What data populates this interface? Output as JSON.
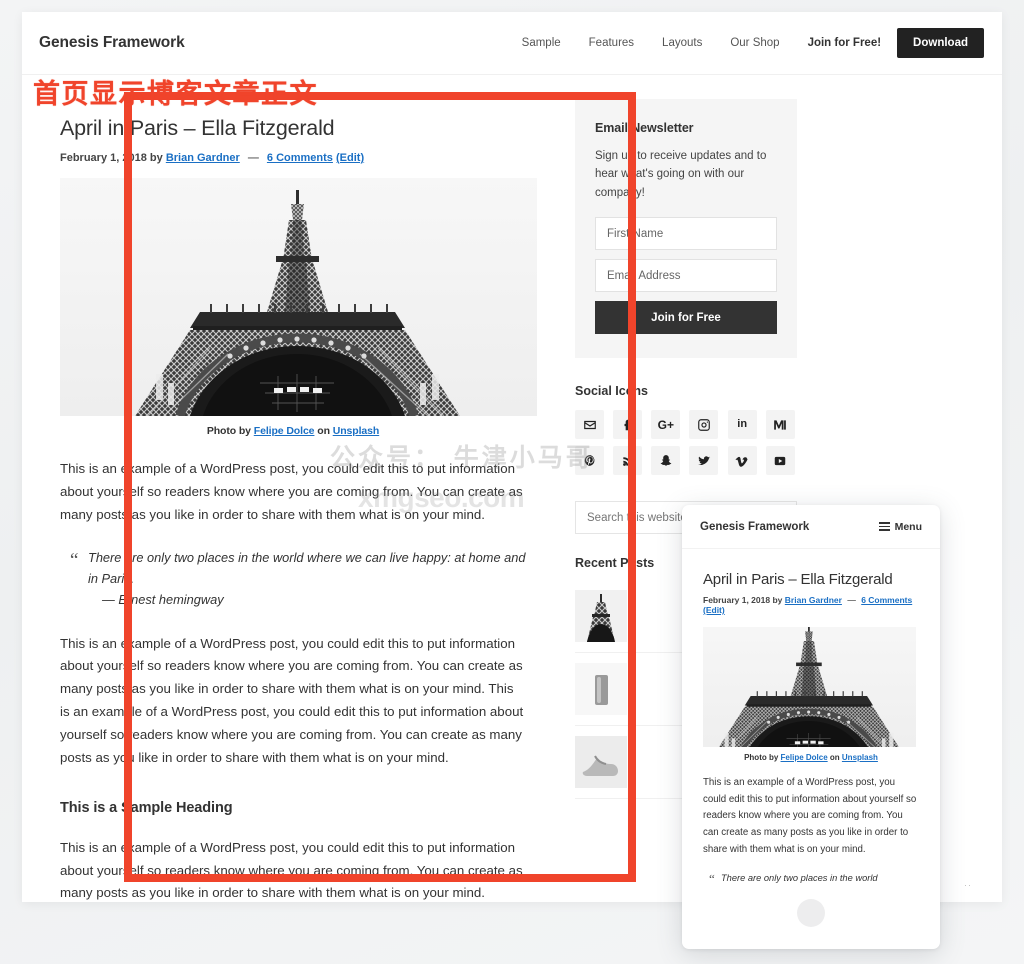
{
  "site": {
    "title": "Genesis Framework",
    "nav": [
      {
        "label": "Sample",
        "bold": false
      },
      {
        "label": "Features",
        "bold": false
      },
      {
        "label": "Layouts",
        "bold": false
      },
      {
        "label": "Our Shop",
        "bold": false
      },
      {
        "label": "Join for Free!",
        "bold": true
      }
    ],
    "download_button": "Download"
  },
  "annotation": {
    "text": "首页显示博客文章正文",
    "color": "#f0442b"
  },
  "watermark": {
    "line1": "公众号： 牛津小马哥",
    "line2": "xmgseo.com"
  },
  "post": {
    "title": "April in Paris – Ella Fitzgerald",
    "date": "February 1, 2018",
    "by_label": "by",
    "author": "Brian Gardner",
    "dash": "—",
    "comments": "6 Comments",
    "edit": "(Edit)",
    "photo_credit_prefix": "Photo by",
    "photo_author": "Felipe Dolce",
    "photo_on": "on",
    "photo_source": "Unsplash",
    "paragraph_1": "This is an example of a WordPress post, you could edit this to put information about yourself so readers know where you are coming from. You can create as many posts as you like in order to share with them what is on your mind.",
    "quote": "There are only two places in the world where we can live happy: at home and in Paris.",
    "quote_attribution": "— Ernest hemingway",
    "paragraph_2": "This is an example of a WordPress post, you could edit this to put information about yourself so readers know where you are coming from. You can create as many posts as you like in order to share with them what is on your mind. This is an example of a WordPress post, you could edit this to put information about yourself so readers know where you are coming from. You can create as many posts as you like in order to share with them what is on your mind.",
    "subheading": "This is a Sample Heading",
    "paragraph_3": "This is an example of a WordPress post, you could edit this to put information about yourself so readers know where you are coming from. You can create as many posts as you like in order to share with them what is on your mind."
  },
  "sidebar": {
    "newsletter": {
      "title": "Email Newsletter",
      "copy": "Sign up to receive updates and to hear what's going on with our company!",
      "first_name_placeholder": "First Name",
      "email_placeholder": "Email Address",
      "button": "Join for Free"
    },
    "social": {
      "title": "Social Icons",
      "icons": [
        {
          "name": "email-icon",
          "glyph": "✉"
        },
        {
          "name": "facebook-icon",
          "glyph": "f"
        },
        {
          "name": "google-plus-icon",
          "glyph": "G+"
        },
        {
          "name": "instagram-icon",
          "glyph": "▢"
        },
        {
          "name": "linkedin-icon",
          "glyph": "in"
        },
        {
          "name": "medium-icon",
          "glyph": "M"
        },
        {
          "name": "pinterest-icon",
          "glyph": "P"
        },
        {
          "name": "rss-icon",
          "glyph": "◔"
        },
        {
          "name": "snapchat-icon",
          "glyph": "◕"
        },
        {
          "name": "twitter-icon",
          "glyph": "▶"
        },
        {
          "name": "vimeo-icon",
          "glyph": "V"
        },
        {
          "name": "youtube-icon",
          "glyph": "▸"
        }
      ]
    },
    "search_placeholder": "Search this website …",
    "recent_title": "Recent Posts",
    "recent_items": [
      "thumb-eiffel",
      "thumb-bottle",
      "thumb-shoes"
    ]
  },
  "mobile_preview": {
    "site_title": "Genesis Framework",
    "menu_label": "Menu",
    "post_title": "April in Paris – Ella Fitzgerald",
    "date": "February 1, 2018",
    "by_label": "by",
    "author": "Brian Gardner",
    "dash": "—",
    "comments": "6 Comments",
    "edit": "(Edit)",
    "photo_credit_prefix": "Photo by",
    "photo_author": "Felipe Dolce",
    "photo_on": "on",
    "photo_source": "Unsplash",
    "paragraph": "This is an example of a WordPress post, you could edit this to put information about yourself so readers know where you are coming from. You can create as many posts as you like in order to share with them what is on your mind.",
    "quote": "There are only two places in the world"
  }
}
